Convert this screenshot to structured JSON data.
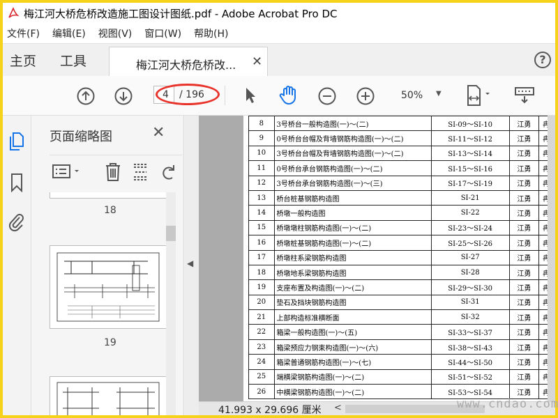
{
  "window": {
    "title": "梅江河大桥危桥改造施工图设计图纸.pdf - Adobe Acrobat Pro DC",
    "logo_icon": "acrobat-logo-icon"
  },
  "menu": [
    "文件(F)",
    "编辑(E)",
    "视图(V)",
    "窗口(W)",
    "帮助(H)"
  ],
  "tabs": {
    "home": "主页",
    "tools": "工具",
    "document": "梅江河大桥危桥改...",
    "close": "✕",
    "help": "?"
  },
  "toolbar": {
    "page_current": "4",
    "page_total": "/ 196",
    "zoom": "50%",
    "icons": [
      "prev-page-icon",
      "next-page-icon",
      "select-arrow-icon",
      "hand-tool-icon",
      "zoom-out-icon",
      "zoom-in-icon",
      "fit-page-icon",
      "keyboard-tool-icon"
    ]
  },
  "sidebar": {
    "title": "页面缩略图",
    "close": "✕",
    "thumbnails": [
      {
        "page": "18"
      },
      {
        "page": "19"
      },
      {
        "page": ""
      }
    ]
  },
  "document": {
    "rows": [
      {
        "no": "8",
        "name": "3号桥台一般构造图(一)～(二)",
        "code": "SI-09～SI-10",
        "d1": "江勇",
        "d2": "冉启"
      },
      {
        "no": "9",
        "name": "0号桥台台帽及背墙钢筋构造图(一)～(二)",
        "code": "SI-11～SI-12",
        "d1": "江勇",
        "d2": "冉启"
      },
      {
        "no": "10",
        "name": "3号桥台台帽及背墙钢筋构造图(一)～(二)",
        "code": "SI-13～SI-14",
        "d1": "江勇",
        "d2": "冉启"
      },
      {
        "no": "11",
        "name": "0号桥台承台钢筋构造图(一)～(二)",
        "code": "SI-15～SI-16",
        "d1": "江勇",
        "d2": "冉启"
      },
      {
        "no": "12",
        "name": "3号桥台承台钢筋构造图(一)～(三)",
        "code": "SI-17～SI-19",
        "d1": "江勇",
        "d2": "冉启"
      },
      {
        "no": "13",
        "name": "桥台桩基钢筋构造图",
        "code": "SI-21",
        "d1": "江勇",
        "d2": "冉启"
      },
      {
        "no": "14",
        "name": "桥墩一般构造图",
        "code": "SI-22",
        "d1": "江勇",
        "d2": "冉启"
      },
      {
        "no": "15",
        "name": "桥墩墩柱钢筋构造图(一)～(二)",
        "code": "SI-23～SI-24",
        "d1": "江勇",
        "d2": "冉启"
      },
      {
        "no": "16",
        "name": "桥墩桩基钢筋构造图(一)～(二)",
        "code": "SI-25～SI-26",
        "d1": "江勇",
        "d2": "冉启"
      },
      {
        "no": "17",
        "name": "桥墩柱系梁钢筋构造图",
        "code": "SI-27",
        "d1": "江勇",
        "d2": "冉启"
      },
      {
        "no": "18",
        "name": "桥墩地系梁钢筋构造图",
        "code": "SI-28",
        "d1": "江勇",
        "d2": "冉启"
      },
      {
        "no": "19",
        "name": "支座布置及构造图(一)～(二)",
        "code": "SI-29～SI-30",
        "d1": "江勇",
        "d2": "冉启"
      },
      {
        "no": "20",
        "name": "垫石及挡块钢筋构造图",
        "code": "SI-31",
        "d1": "江勇",
        "d2": "冉启"
      },
      {
        "no": "21",
        "name": "上部构造标准横断面",
        "code": "SI-32",
        "d1": "江勇",
        "d2": "冉启"
      },
      {
        "no": "22",
        "name": "箱梁一般构造图(一)～(五)",
        "code": "SI-33～SI-37",
        "d1": "江勇",
        "d2": "冉启"
      },
      {
        "no": "23",
        "name": "箱梁预应力钢束构造图(一)～(六)",
        "code": "SI-38～SI-43",
        "d1": "江勇",
        "d2": "冉启"
      },
      {
        "no": "24",
        "name": "箱梁普通钢筋构造图(一)～(七)",
        "code": "SI-44～SI-50",
        "d1": "江勇",
        "d2": "冉启"
      },
      {
        "no": "25",
        "name": "端横梁钢筋构造图(一)～(二)",
        "code": "SI-51～SI-52",
        "d1": "江勇",
        "d2": "冉启"
      },
      {
        "no": "26",
        "name": "中横梁钢筋构造图(一)～(二)",
        "code": "SI-53～SI-54",
        "d1": "江勇",
        "d2": "冉启"
      }
    ]
  },
  "status": {
    "page_size": "41.993 x 29.696 厘米",
    "scroll_left": "<"
  },
  "watermark": "www.cndao.com"
}
